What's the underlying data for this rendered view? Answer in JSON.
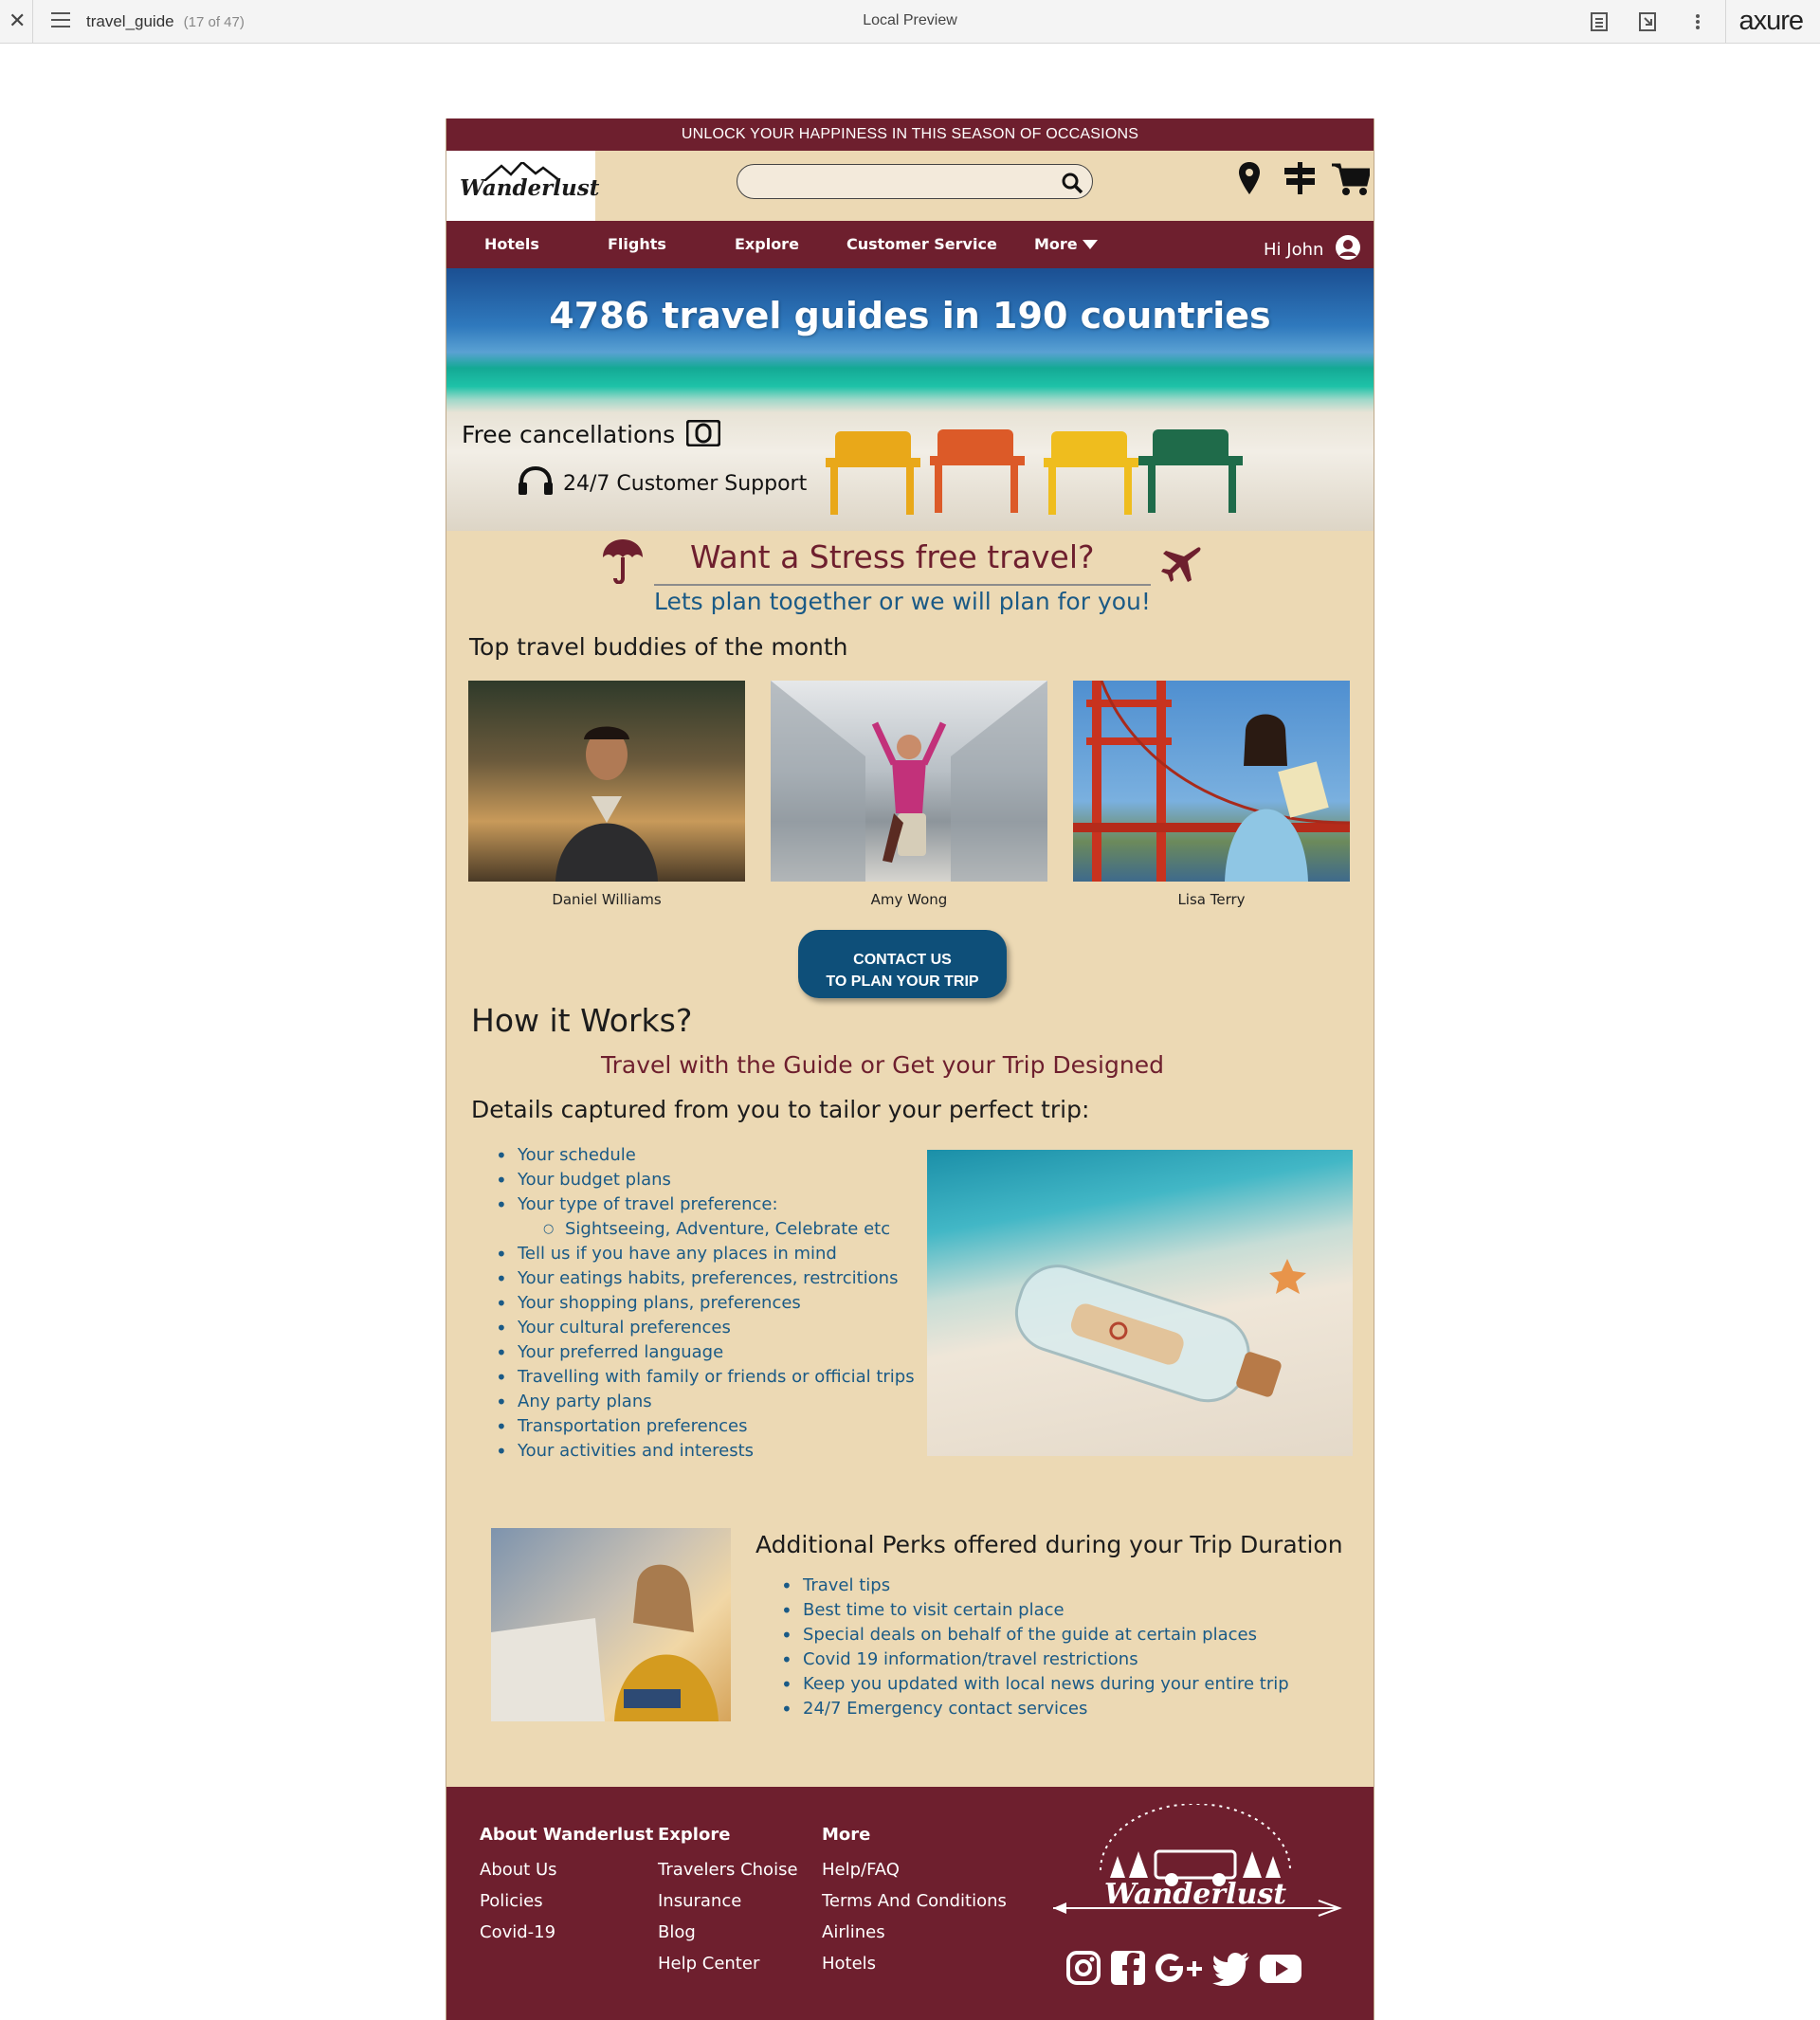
{
  "viewer": {
    "close_glyph": "✕",
    "file_name": "travel_guide",
    "page_count": "(17 of 47)",
    "center_title": "Local Preview",
    "brand": "axure"
  },
  "promo_bar": {
    "text": "UNLOCK YOUR HAPPINESS IN THIS SEASON OF OCCASIONS"
  },
  "header": {
    "logo_text": "Wanderlust",
    "search": {
      "value": "",
      "placeholder": ""
    },
    "icons": [
      "location-pin-icon",
      "signpost-icon",
      "cart-icon"
    ]
  },
  "nav": {
    "items": [
      "Hotels",
      "Flights",
      "Explore",
      "Customer Service",
      "More"
    ],
    "greeting": "Hi John"
  },
  "hero": {
    "title": "4786 travel guides in 190 countries",
    "free_cancellations": "Free cancellations",
    "support": "24/7 Customer Support"
  },
  "stress": {
    "title": "Want a Stress free travel?",
    "subtitle": "Lets plan together or we will plan for you!"
  },
  "buddies": {
    "heading": "Top travel buddies of the month",
    "people": [
      {
        "name": "Daniel Williams"
      },
      {
        "name": "Amy Wong"
      },
      {
        "name": "Lisa Terry"
      }
    ]
  },
  "contact_button": {
    "line1": "CONTACT US",
    "line2": "TO PLAN YOUR TRIP"
  },
  "how": {
    "heading": "How it Works?",
    "tagline": "Travel with the Guide or Get your Trip Designed",
    "details_heading": "Details captured from you to tailor your perfect trip:",
    "details": [
      "Your schedule",
      "Your budget plans",
      "Your type of travel preference:",
      "Sightseeing, Adventure, Celebrate etc",
      "Tell us if you have any places in mind",
      "Your eatings habits, preferences, restrcitions",
      "Your shopping plans, preferences",
      "Your cultural preferences",
      "Your preferred language",
      "Travelling with family or friends or official trips",
      "Any party plans",
      "Transportation preferences",
      "Your activities and interests"
    ]
  },
  "perks": {
    "heading": "Additional Perks offered during your Trip Duration",
    "items": [
      "Travel tips",
      "Best time to visit certain place",
      "Special deals on behalf of the guide at certain places",
      "Covid 19 information/travel restrictions",
      "Keep you updated with local news during your entire trip",
      "24/7 Emergency contact services"
    ]
  },
  "footer": {
    "about": {
      "heading": "About Wanderlust",
      "links": [
        "About Us",
        "Policies",
        "Covid-19"
      ]
    },
    "explore": {
      "heading": "Explore",
      "links": [
        "Travelers Choise",
        "Insurance",
        "Blog",
        "Help Center"
      ]
    },
    "more": {
      "heading": "More",
      "links": [
        "Help/FAQ",
        "Terms And Conditions",
        "Airlines",
        "Hotels"
      ]
    },
    "logo_text": "Wanderlust",
    "social": [
      "instagram-icon",
      "facebook-icon",
      "google-plus-icon",
      "twitter-icon",
      "youtube-icon"
    ]
  },
  "colors": {
    "maroon": "#6e1f2e",
    "sand": "#ecd9b4",
    "blue_text": "#1a5a86",
    "button_blue": "#0e4f79"
  }
}
